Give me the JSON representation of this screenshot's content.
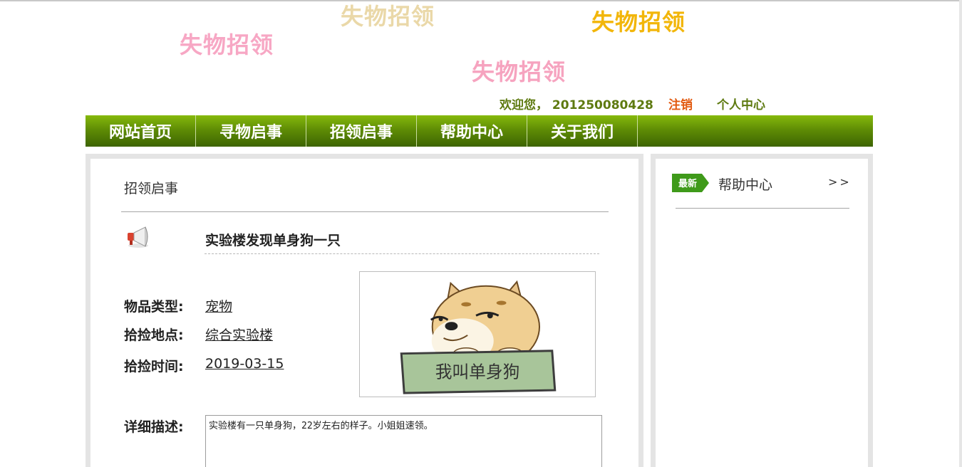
{
  "banner": {
    "texts": [
      "失物招领",
      "失物招领",
      "失物招领",
      "失物招领"
    ]
  },
  "user_bar": {
    "welcome": "欢迎您， 201250080428",
    "logout": "注销",
    "profile": "个人中心"
  },
  "nav": {
    "items": [
      "网站首页",
      "寻物启事",
      "招领启事",
      "帮助中心",
      "关于我们"
    ]
  },
  "main": {
    "section_title": "招领启事",
    "post_title": "实验楼发现单身狗一只",
    "fields": [
      {
        "label": "物品类型:",
        "value": "宠物"
      },
      {
        "label": "拾捡地点:",
        "value": "综合实验楼"
      },
      {
        "label": "拾捡时间:",
        "value": "2019-03-15"
      }
    ],
    "photo_caption": "我叫单身狗",
    "description_label": "详细描述:",
    "description_value": "实验楼有一只单身狗，22岁左右的样子。小姐姐速领。"
  },
  "sidebar": {
    "badge": "最新",
    "title": "帮助中心",
    "more": ">>"
  },
  "colors": {
    "nav_green": "#5f8d05",
    "user_green": "#5e7a10",
    "logout_orange": "#e25a10",
    "badge_green": "#3f9a1a"
  },
  "icons": {
    "megaphone": "megaphone-icon",
    "photo": "doge-photo"
  }
}
